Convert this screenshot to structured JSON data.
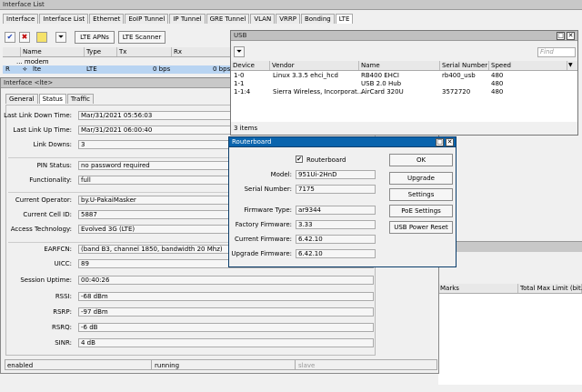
{
  "iflist": {
    "title": "Interface List",
    "tabs": [
      "Interface",
      "Interface List",
      "Ethernet",
      "EoIP Tunnel",
      "IP Tunnel",
      "GRE Tunnel",
      "VLAN",
      "VRRP",
      "Bonding",
      "LTE"
    ],
    "toolbar_buttons": [
      "LTE APNs",
      "LTE Scanner"
    ],
    "columns": [
      "Name",
      "Type",
      "Tx",
      "Rx"
    ],
    "group": "... modem",
    "row": {
      "flag": "R",
      "name": "lte",
      "type": "LTE",
      "tx": "0 bps",
      "rx": "0 bps"
    }
  },
  "lte": {
    "title": "Interface <lte>",
    "tabs": [
      "General",
      "Status",
      "Traffic"
    ],
    "fields": [
      {
        "label": "Last Link Down Time:",
        "value": "Mar/31/2021 05:56:03"
      },
      {
        "label": "Last Link Up Time:",
        "value": "Mar/31/2021 06:00:40"
      },
      {
        "label": "Link Downs:",
        "value": "3"
      },
      {
        "label": "PIN Status:",
        "value": "no password required"
      },
      {
        "label": "Functionality:",
        "value": "full"
      },
      {
        "label": "Current Operator:",
        "value": "by.U-PakaiMasker"
      },
      {
        "label": "Current Cell ID:",
        "value": "5887"
      },
      {
        "label": "Access Technology:",
        "value": "Evolved 3G (LTE)"
      },
      {
        "label": "EARFCN:",
        "value": "(band B3, channel 1850, bandwidth 20 Mhz)"
      },
      {
        "label": "UICC:",
        "value": "89"
      },
      {
        "label": "Session Uptime:",
        "value": "00:40:26"
      },
      {
        "label": "RSSI:",
        "value": "-68 dBm"
      },
      {
        "label": "RSRP:",
        "value": "-97 dBm"
      },
      {
        "label": "RSRQ:",
        "value": "-6 dB"
      },
      {
        "label": "SINR:",
        "value": "4 dB"
      }
    ],
    "status": [
      "enabled",
      "running",
      "slave"
    ]
  },
  "usb": {
    "title": "USB",
    "find_placeholder": "Find",
    "columns": [
      "Device",
      "Vendor",
      "Name",
      "Serial Number",
      "Speed"
    ],
    "rows": [
      {
        "device": "1-0",
        "vendor": "Linux 3.3.5 ehci_hcd",
        "name": "RB400 EHCI",
        "serial": "rb400_usb",
        "speed": "480"
      },
      {
        "device": "1-1",
        "vendor": "",
        "name": "USB 2.0 Hub",
        "serial": "",
        "speed": "480"
      },
      {
        "device": "1-1:4",
        "vendor": "Sierra Wireless, Incorporat...",
        "name": "AirCard 320U",
        "serial": "3572720",
        "speed": "480"
      }
    ],
    "count": "3 items"
  },
  "routerboard": {
    "title": "Routerboard",
    "checkbox_label": "Routerboard",
    "fields": [
      {
        "label": "Model:",
        "value": "951Ui-2HnD"
      },
      {
        "label": "Serial Number:",
        "value": "7175"
      },
      {
        "label": "Firmware Type:",
        "value": "ar9344"
      },
      {
        "label": "Factory Firmware:",
        "value": "3.33"
      },
      {
        "label": "Current Firmware:",
        "value": "6.42.10"
      },
      {
        "label": "Upgrade Firmware:",
        "value": "6.42.10"
      }
    ],
    "buttons": [
      "OK",
      "Upgrade",
      "Settings",
      "PoE Settings",
      "USB Power Reset"
    ]
  },
  "bg": {
    "marks": "Marks",
    "total_max_limit": "Total Max Limit (bit..."
  }
}
